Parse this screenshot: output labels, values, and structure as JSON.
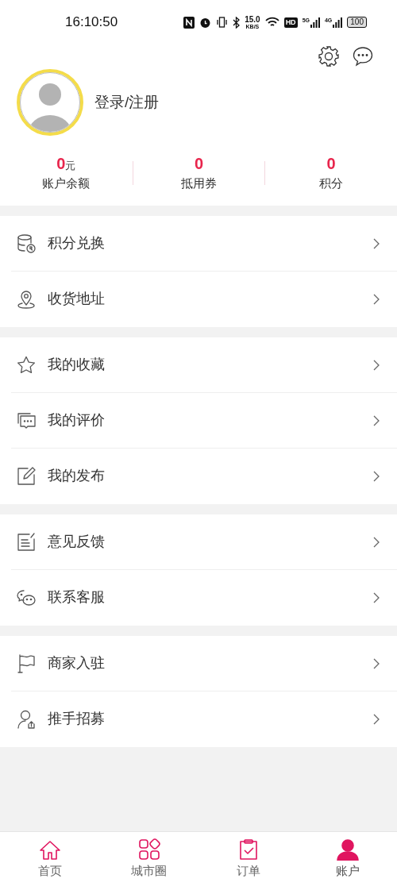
{
  "status_bar": {
    "time": "16:10:50",
    "speed": "15.0",
    "speed_unit": "KB/S",
    "hd": "HD",
    "network_1": "5G",
    "network_2": "4G",
    "battery": "100"
  },
  "profile": {
    "login_label": "登录/注册"
  },
  "stats": [
    {
      "value": "0",
      "unit": "元",
      "label": "账户余额"
    },
    {
      "value": "0",
      "label": "抵用券"
    },
    {
      "value": "0",
      "label": "积分"
    }
  ],
  "menu_groups": [
    [
      {
        "kind": "coins",
        "label": "积分兑换"
      },
      {
        "kind": "location",
        "label": "收货地址"
      }
    ],
    [
      {
        "kind": "star",
        "label": "我的收藏"
      },
      {
        "kind": "comments",
        "label": "我的评价"
      },
      {
        "kind": "edit",
        "label": "我的发布"
      }
    ],
    [
      {
        "kind": "feedback",
        "label": "意见反馈"
      },
      {
        "kind": "chat",
        "label": "联系客服"
      }
    ],
    [
      {
        "kind": "flag",
        "label": "商家入驻"
      },
      {
        "kind": "recruit",
        "label": "推手招募"
      }
    ]
  ],
  "tab_bar": [
    {
      "kind": "home",
      "label": "首页",
      "selected": false
    },
    {
      "kind": "grid",
      "label": "城市圈",
      "selected": false
    },
    {
      "kind": "orders",
      "label": "订单",
      "selected": false
    },
    {
      "kind": "account",
      "label": "账户",
      "selected": true
    }
  ]
}
